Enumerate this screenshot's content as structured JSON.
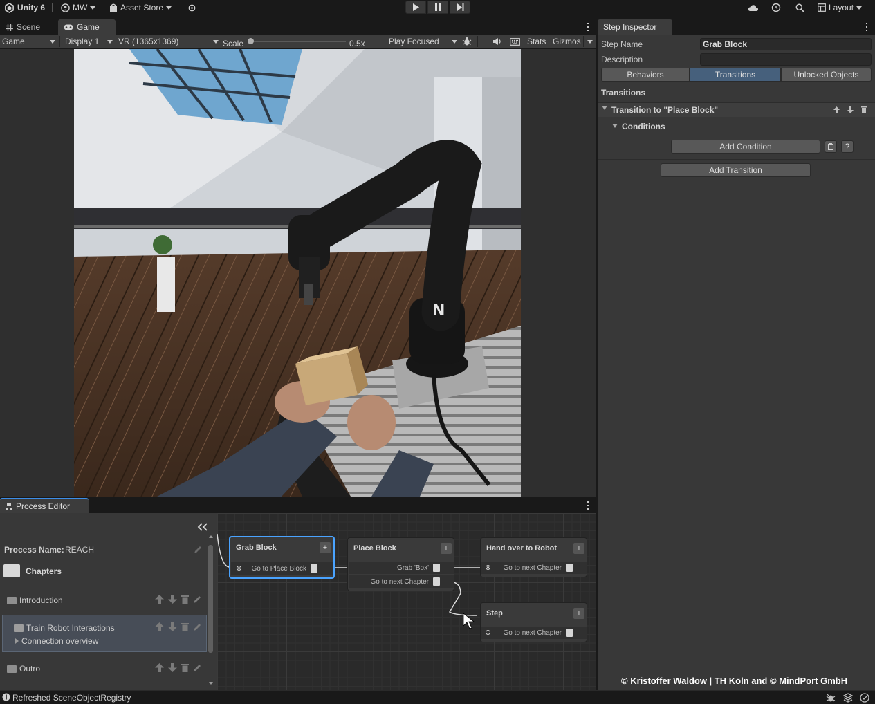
{
  "toolbar": {
    "app_label": "Unity 6",
    "account_label": "MW",
    "asset_store_label": "Asset Store",
    "layout_label": "Layout"
  },
  "tabs": {
    "scene": "Scene",
    "game": "Game",
    "inspector": "Step Inspector",
    "process_editor": "Process Editor"
  },
  "game_toolbar": {
    "mode": "Game",
    "display": "Display 1",
    "resolution": "VR (1365x1369)",
    "scale_label": "Scale",
    "scale_value": "0.5x",
    "play_mode": "Play Focused",
    "stats": "Stats",
    "gizmos": "Gizmos"
  },
  "inspector": {
    "step_name_label": "Step Name",
    "step_name_value": "Grab Block",
    "description_label": "Description",
    "description_value": "",
    "segments": [
      "Behaviors",
      "Transitions",
      "Unlocked Objects"
    ],
    "active_segment": "Transitions",
    "transitions_header": "Transitions",
    "transition_title": "Transition to \"Place Block\"",
    "conditions_label": "Conditions",
    "add_condition": "Add Condition",
    "help": "?",
    "add_transition": "Add Transition"
  },
  "process": {
    "name_label": "Process Name:",
    "name_value": "REACH",
    "chapters_label": "Chapters",
    "chapters": [
      {
        "name": "Introduction"
      },
      {
        "name": "Train Robot Interactions",
        "sub": "Connection overview"
      },
      {
        "name": "Outro"
      }
    ]
  },
  "graph": {
    "nodes": [
      {
        "title": "Grab Block",
        "ports": [
          "Go to Place Block"
        ]
      },
      {
        "title": "Place Block",
        "ports": [
          "Grab 'Box'",
          "Go to next Chapter"
        ]
      },
      {
        "title": "Hand over to Robot",
        "ports": [
          "Go to next Chapter"
        ]
      },
      {
        "title": "Step",
        "ports": [
          "Go to next Chapter"
        ]
      }
    ],
    "plus": "+"
  },
  "watermark": "© Kristoffer Waldow | TH Köln and © MindPort GmbH",
  "status": "Refreshed SceneObjectRegistry"
}
